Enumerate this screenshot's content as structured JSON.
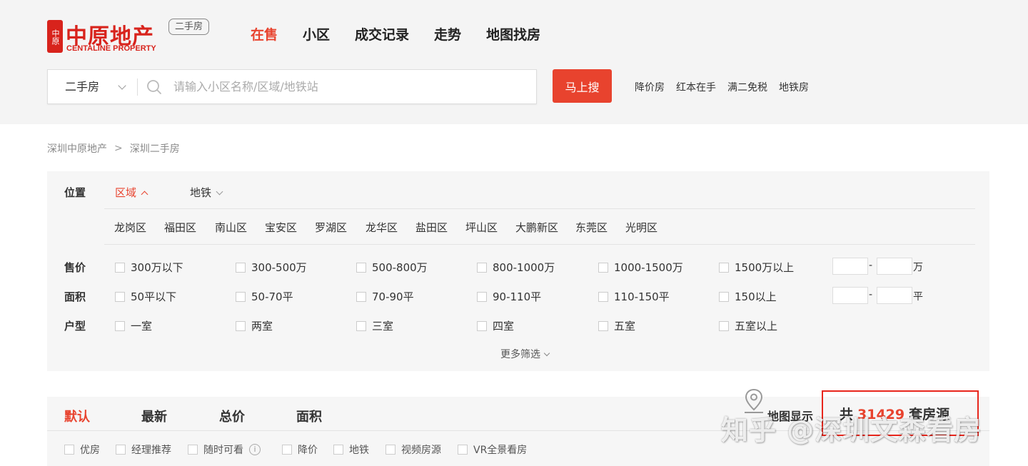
{
  "logo": {
    "seal_text": "中原",
    "cn": "中原地产",
    "en": "CENTALINE PROPERTY",
    "badge": "二手房"
  },
  "nav": {
    "items": [
      {
        "label": "在售",
        "active": true
      },
      {
        "label": "小区"
      },
      {
        "label": "成交记录"
      },
      {
        "label": "走势"
      },
      {
        "label": "地图找房"
      }
    ]
  },
  "search": {
    "type": "二手房",
    "placeholder": "请输入小区名称/区域/地铁站",
    "button": "马上搜",
    "quick_links": [
      "降价房",
      "红本在手",
      "满二免税",
      "地铁房"
    ]
  },
  "breadcrumb": {
    "items": [
      "深圳中原地产",
      "深圳二手房"
    ],
    "separator": ">"
  },
  "filter": {
    "location": {
      "label": "位置",
      "tabs": [
        {
          "label": "区域",
          "active": true
        },
        {
          "label": "地铁"
        }
      ],
      "districts": [
        "龙岗区",
        "福田区",
        "南山区",
        "宝安区",
        "罗湖区",
        "龙华区",
        "盐田区",
        "坪山区",
        "大鹏新区",
        "东莞区",
        "光明区"
      ]
    },
    "price": {
      "label": "售价",
      "options": [
        "300万以下",
        "300-500万",
        "500-800万",
        "800-1000万",
        "1000-1500万",
        "1500万以上"
      ],
      "dash": "-",
      "unit": "万"
    },
    "area": {
      "label": "面积",
      "options": [
        "50平以下",
        "50-70平",
        "70-90平",
        "90-110平",
        "110-150平",
        "150以上"
      ],
      "dash": "-",
      "unit": "平"
    },
    "layout": {
      "label": "户型",
      "options": [
        "一室",
        "两室",
        "三室",
        "四室",
        "五室",
        "五室以上"
      ]
    },
    "more": "更多筛选"
  },
  "sort": {
    "items": [
      {
        "label": "默认",
        "active": true
      },
      {
        "label": "最新"
      },
      {
        "label": "总价"
      },
      {
        "label": "面积"
      }
    ],
    "tags": [
      "优房",
      "经理推荐",
      "随时可看",
      "降价",
      "地铁",
      "视频房源",
      "VR全景看房"
    ],
    "info_glyph": "i",
    "map_view": "地图显示",
    "total_prefix": "共",
    "total_count": "31429",
    "total_suffix": "套房源"
  },
  "watermark": "知乎 @深圳文森看房",
  "colors": {
    "accent": "#e8432e",
    "header_bg": "#f4f4f4",
    "panel_bg": "#f6f6f6",
    "highlight_border": "#e8261c"
  }
}
